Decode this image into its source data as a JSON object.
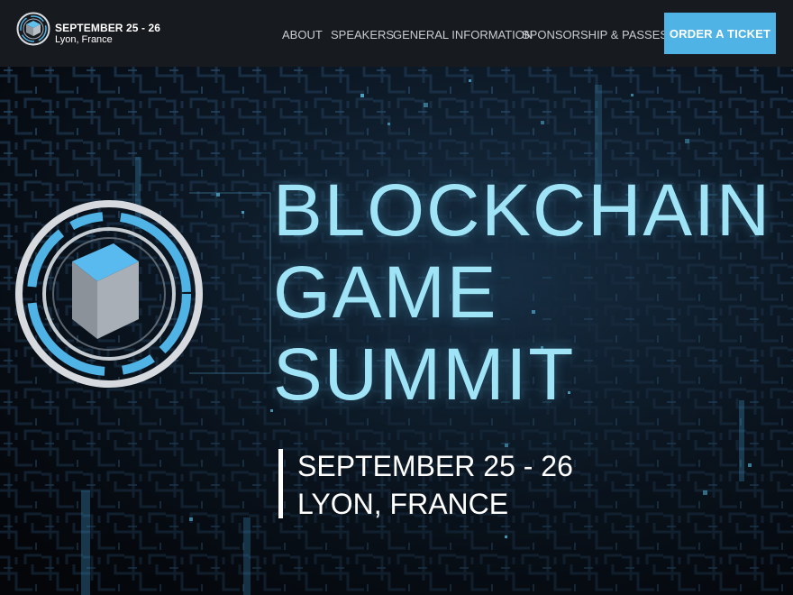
{
  "header": {
    "brand_date": "SEPTEMBER 25 - 26",
    "brand_place": "Lyon, France",
    "nav": [
      {
        "label": "ABOUT"
      },
      {
        "label": "SPEAKERS"
      },
      {
        "label": "GENERAL INFORMATION"
      },
      {
        "label": "SPONSORSHIP & PASSES"
      }
    ],
    "cta_label": "ORDER A TICKET"
  },
  "hero": {
    "title_lines": [
      "BLOCKCHAIN",
      "GAME",
      "SUMMIT"
    ],
    "date": "SEPTEMBER 25 - 26",
    "place": "LYON, FRANCE"
  },
  "colors": {
    "accent": "#4fb3e6",
    "title": "#9fe3f6",
    "header_bg": "#171a1e",
    "hero_bg": "#0a0f17"
  },
  "icons": [
    "cube-logo-icon",
    "cube-emblem-icon"
  ]
}
